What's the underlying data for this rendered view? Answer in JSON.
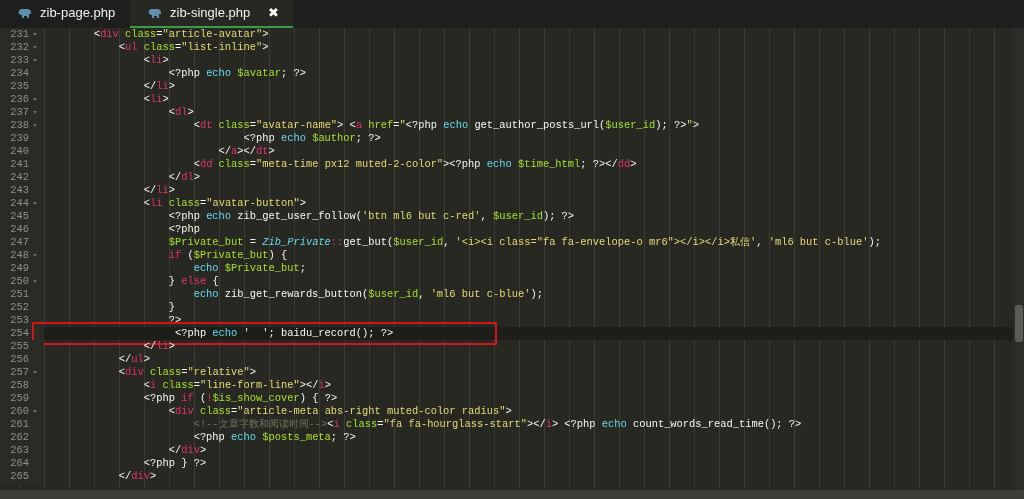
{
  "tabs": [
    {
      "label": "zib-page.php",
      "selected": false
    },
    {
      "label": "zib-single.php",
      "selected": true,
      "close": "✖"
    }
  ],
  "lines": [
    {
      "number": "231",
      "foldable": true,
      "current": false,
      "marked": false,
      "tokens": [
        {
          "kind": "p",
          "text": "        <"
        },
        {
          "kind": "t",
          "text": "div "
        },
        {
          "kind": "a",
          "text": "class"
        },
        {
          "kind": "p",
          "text": "="
        },
        {
          "kind": "s",
          "text": "\"article-avatar\""
        },
        {
          "kind": "p",
          "text": ">"
        }
      ]
    },
    {
      "number": "232",
      "foldable": true,
      "current": false,
      "marked": false,
      "tokens": [
        {
          "kind": "p",
          "text": "            <"
        },
        {
          "kind": "t",
          "text": "ul "
        },
        {
          "kind": "a",
          "text": "class"
        },
        {
          "kind": "p",
          "text": "="
        },
        {
          "kind": "s",
          "text": "\"list-inline\""
        },
        {
          "kind": "p",
          "text": ">"
        }
      ]
    },
    {
      "number": "233",
      "foldable": true,
      "current": false,
      "marked": false,
      "tokens": [
        {
          "kind": "p",
          "text": "                <"
        },
        {
          "kind": "t",
          "text": "li"
        },
        {
          "kind": "p",
          "text": ">"
        }
      ]
    },
    {
      "number": "234",
      "foldable": false,
      "current": false,
      "marked": false,
      "tokens": [
        {
          "kind": "p",
          "text": "                    <?php "
        },
        {
          "kind": "e",
          "text": "echo "
        },
        {
          "kind": "v",
          "text": "$avatar"
        },
        {
          "kind": "p",
          "text": "; ?>"
        }
      ]
    },
    {
      "number": "235",
      "foldable": false,
      "current": false,
      "marked": false,
      "tokens": [
        {
          "kind": "p",
          "text": "                </"
        },
        {
          "kind": "t",
          "text": "li"
        },
        {
          "kind": "p",
          "text": ">"
        }
      ]
    },
    {
      "number": "236",
      "foldable": true,
      "current": false,
      "marked": false,
      "tokens": [
        {
          "kind": "p",
          "text": "                <"
        },
        {
          "kind": "t",
          "text": "li"
        },
        {
          "kind": "p",
          "text": ">"
        }
      ]
    },
    {
      "number": "237",
      "foldable": true,
      "current": false,
      "marked": false,
      "tokens": [
        {
          "kind": "p",
          "text": "                    <"
        },
        {
          "kind": "t",
          "text": "dl"
        },
        {
          "kind": "p",
          "text": ">"
        }
      ]
    },
    {
      "number": "238",
      "foldable": true,
      "current": false,
      "marked": false,
      "tokens": [
        {
          "kind": "p",
          "text": "                        <"
        },
        {
          "kind": "t",
          "text": "dt "
        },
        {
          "kind": "a",
          "text": "class"
        },
        {
          "kind": "p",
          "text": "="
        },
        {
          "kind": "s",
          "text": "\"avatar-name\""
        },
        {
          "kind": "p",
          "text": "> <"
        },
        {
          "kind": "t",
          "text": "a "
        },
        {
          "kind": "a",
          "text": "href"
        },
        {
          "kind": "p",
          "text": "="
        },
        {
          "kind": "s",
          "text": "\""
        },
        {
          "kind": "p",
          "text": "<?php "
        },
        {
          "kind": "e",
          "text": "echo"
        },
        {
          "kind": "p",
          "text": " get_author_posts_url("
        },
        {
          "kind": "v",
          "text": "$user_id"
        },
        {
          "kind": "p",
          "text": "); ?>"
        },
        {
          "kind": "s",
          "text": "\""
        },
        {
          "kind": "p",
          "text": ">"
        }
      ]
    },
    {
      "number": "239",
      "foldable": false,
      "current": false,
      "marked": false,
      "tokens": [
        {
          "kind": "p",
          "text": "                                <?php "
        },
        {
          "kind": "e",
          "text": "echo "
        },
        {
          "kind": "v",
          "text": "$author"
        },
        {
          "kind": "p",
          "text": "; ?>"
        }
      ]
    },
    {
      "number": "240",
      "foldable": false,
      "current": false,
      "marked": false,
      "tokens": [
        {
          "kind": "p",
          "text": "                            </"
        },
        {
          "kind": "t",
          "text": "a"
        },
        {
          "kind": "p",
          "text": "></"
        },
        {
          "kind": "t",
          "text": "dt"
        },
        {
          "kind": "p",
          "text": ">"
        }
      ]
    },
    {
      "number": "241",
      "foldable": false,
      "current": false,
      "marked": false,
      "tokens": [
        {
          "kind": "p",
          "text": "                        <"
        },
        {
          "kind": "t",
          "text": "dd "
        },
        {
          "kind": "a",
          "text": "class"
        },
        {
          "kind": "p",
          "text": "="
        },
        {
          "kind": "s",
          "text": "\"meta-time px12 muted-2-color\""
        },
        {
          "kind": "p",
          "text": "><?php "
        },
        {
          "kind": "e",
          "text": "echo "
        },
        {
          "kind": "v",
          "text": "$time_html"
        },
        {
          "kind": "p",
          "text": "; ?></"
        },
        {
          "kind": "t",
          "text": "dd"
        },
        {
          "kind": "p",
          "text": ">"
        }
      ]
    },
    {
      "number": "242",
      "foldable": false,
      "current": false,
      "marked": false,
      "tokens": [
        {
          "kind": "p",
          "text": "                    </"
        },
        {
          "kind": "t",
          "text": "dl"
        },
        {
          "kind": "p",
          "text": ">"
        }
      ]
    },
    {
      "number": "243",
      "foldable": false,
      "current": false,
      "marked": false,
      "tokens": [
        {
          "kind": "p",
          "text": "                </"
        },
        {
          "kind": "t",
          "text": "li"
        },
        {
          "kind": "p",
          "text": ">"
        }
      ]
    },
    {
      "number": "244",
      "foldable": true,
      "current": false,
      "marked": false,
      "tokens": [
        {
          "kind": "p",
          "text": "                <"
        },
        {
          "kind": "t",
          "text": "li "
        },
        {
          "kind": "a",
          "text": "class"
        },
        {
          "kind": "p",
          "text": "="
        },
        {
          "kind": "s",
          "text": "\"avatar-button\""
        },
        {
          "kind": "p",
          "text": ">"
        }
      ]
    },
    {
      "number": "245",
      "foldable": false,
      "current": false,
      "marked": false,
      "tokens": [
        {
          "kind": "p",
          "text": "                    <?php "
        },
        {
          "kind": "e",
          "text": "echo"
        },
        {
          "kind": "p",
          "text": " zib_get_user_follow("
        },
        {
          "kind": "s",
          "text": "'btn ml6 but c-red'"
        },
        {
          "kind": "p",
          "text": ", "
        },
        {
          "kind": "v",
          "text": "$user_id"
        },
        {
          "kind": "p",
          "text": "); ?>"
        }
      ]
    },
    {
      "number": "246",
      "foldable": false,
      "current": false,
      "marked": false,
      "tokens": [
        {
          "kind": "p",
          "text": "                    <?php"
        }
      ]
    },
    {
      "number": "247",
      "foldable": false,
      "current": false,
      "marked": false,
      "tokens": [
        {
          "kind": "v",
          "text": "                    $Private_but"
        },
        {
          "kind": "p",
          "text": " = "
        },
        {
          "kind": "c",
          "text": "Zib_Private"
        },
        {
          "kind": "r",
          "text": "::"
        },
        {
          "kind": "p",
          "text": "get_but("
        },
        {
          "kind": "v",
          "text": "$user_id"
        },
        {
          "kind": "p",
          "text": ", "
        },
        {
          "kind": "s",
          "text": "'<i><i class=\"fa fa-envelope-o mr6\"></i></i>私信'"
        },
        {
          "kind": "p",
          "text": ", "
        },
        {
          "kind": "s",
          "text": "'ml6 but c-blue'"
        },
        {
          "kind": "p",
          "text": ");"
        }
      ]
    },
    {
      "number": "248",
      "foldable": true,
      "current": false,
      "marked": false,
      "tokens": [
        {
          "kind": "r",
          "text": "                    if"
        },
        {
          "kind": "p",
          "text": " ("
        },
        {
          "kind": "v",
          "text": "$Private_but"
        },
        {
          "kind": "p",
          "text": ") {"
        }
      ]
    },
    {
      "number": "249",
      "foldable": false,
      "current": false,
      "marked": false,
      "tokens": [
        {
          "kind": "e",
          "text": "                        echo "
        },
        {
          "kind": "v",
          "text": "$Private_but"
        },
        {
          "kind": "p",
          "text": ";"
        }
      ]
    },
    {
      "number": "250",
      "foldable": true,
      "current": false,
      "marked": false,
      "tokens": [
        {
          "kind": "p",
          "text": "                    } "
        },
        {
          "kind": "r",
          "text": "else"
        },
        {
          "kind": "p",
          "text": " {"
        }
      ]
    },
    {
      "number": "251",
      "foldable": false,
      "current": false,
      "marked": false,
      "tokens": [
        {
          "kind": "e",
          "text": "                        echo"
        },
        {
          "kind": "p",
          "text": " zib_get_rewards_button("
        },
        {
          "kind": "v",
          "text": "$user_id"
        },
        {
          "kind": "p",
          "text": ", "
        },
        {
          "kind": "s",
          "text": "'ml6 but c-blue'"
        },
        {
          "kind": "p",
          "text": ");"
        }
      ]
    },
    {
      "number": "252",
      "foldable": false,
      "current": false,
      "marked": false,
      "tokens": [
        {
          "kind": "p",
          "text": "                    }"
        }
      ]
    },
    {
      "number": "253",
      "foldable": false,
      "current": false,
      "marked": false,
      "tokens": [
        {
          "kind": "p",
          "text": "                    ?>"
        }
      ]
    },
    {
      "number": "254",
      "foldable": false,
      "current": true,
      "marked": true,
      "tokens": [
        {
          "kind": "p",
          "text": "                     <?php "
        },
        {
          "kind": "e",
          "text": "echo"
        },
        {
          "kind": "p",
          "text": " '  '; baidu_record(); ?>"
        }
      ]
    },
    {
      "number": "255",
      "foldable": false,
      "current": false,
      "marked": false,
      "tokens": [
        {
          "kind": "p",
          "text": "                </"
        },
        {
          "kind": "t",
          "text": "li"
        },
        {
          "kind": "p",
          "text": ">"
        }
      ]
    },
    {
      "number": "256",
      "foldable": false,
      "current": false,
      "marked": false,
      "tokens": [
        {
          "kind": "p",
          "text": "            </"
        },
        {
          "kind": "t",
          "text": "ul"
        },
        {
          "kind": "p",
          "text": ">"
        }
      ]
    },
    {
      "number": "257",
      "foldable": true,
      "current": false,
      "marked": false,
      "tokens": [
        {
          "kind": "p",
          "text": "            <"
        },
        {
          "kind": "t",
          "text": "div "
        },
        {
          "kind": "a",
          "text": "class"
        },
        {
          "kind": "p",
          "text": "="
        },
        {
          "kind": "s",
          "text": "\"relative\""
        },
        {
          "kind": "p",
          "text": ">"
        }
      ]
    },
    {
      "number": "258",
      "foldable": false,
      "current": false,
      "marked": false,
      "tokens": [
        {
          "kind": "p",
          "text": "                <"
        },
        {
          "kind": "t",
          "text": "i "
        },
        {
          "kind": "a",
          "text": "class"
        },
        {
          "kind": "p",
          "text": "="
        },
        {
          "kind": "s",
          "text": "\"line-form-line\""
        },
        {
          "kind": "p",
          "text": "></"
        },
        {
          "kind": "t",
          "text": "i"
        },
        {
          "kind": "p",
          "text": ">"
        }
      ]
    },
    {
      "number": "259",
      "foldable": false,
      "current": false,
      "marked": false,
      "tokens": [
        {
          "kind": "p",
          "text": "                <?php "
        },
        {
          "kind": "r",
          "text": "if"
        },
        {
          "kind": "p",
          "text": " ("
        },
        {
          "kind": "r",
          "text": "!"
        },
        {
          "kind": "v",
          "text": "$is_show_cover"
        },
        {
          "kind": "p",
          "text": ") { ?>"
        }
      ]
    },
    {
      "number": "260",
      "foldable": true,
      "current": false,
      "marked": false,
      "tokens": [
        {
          "kind": "p",
          "text": "                    <"
        },
        {
          "kind": "t",
          "text": "div "
        },
        {
          "kind": "a",
          "text": "class"
        },
        {
          "kind": "p",
          "text": "="
        },
        {
          "kind": "s",
          "text": "\"article-meta abs-right muted-color radius\""
        },
        {
          "kind": "p",
          "text": ">"
        }
      ]
    },
    {
      "number": "261",
      "foldable": false,
      "current": false,
      "marked": false,
      "tokens": [
        {
          "kind": "m",
          "text": "                        <!--文章字数和阅读时间-->"
        },
        {
          "kind": "p",
          "text": "<"
        },
        {
          "kind": "t",
          "text": "i "
        },
        {
          "kind": "a",
          "text": "class"
        },
        {
          "kind": "p",
          "text": "="
        },
        {
          "kind": "s",
          "text": "\"fa fa-hourglass-start\""
        },
        {
          "kind": "p",
          "text": "></"
        },
        {
          "kind": "t",
          "text": "i"
        },
        {
          "kind": "p",
          "text": "> <?php "
        },
        {
          "kind": "e",
          "text": "echo"
        },
        {
          "kind": "p",
          "text": " count_words_read_time(); ?>"
        }
      ]
    },
    {
      "number": "262",
      "foldable": false,
      "current": false,
      "marked": false,
      "tokens": [
        {
          "kind": "p",
          "text": "                        <?php "
        },
        {
          "kind": "e",
          "text": "echo "
        },
        {
          "kind": "v",
          "text": "$posts_meta"
        },
        {
          "kind": "p",
          "text": "; ?>"
        }
      ]
    },
    {
      "number": "263",
      "foldable": false,
      "current": false,
      "marked": false,
      "tokens": [
        {
          "kind": "p",
          "text": "                    </"
        },
        {
          "kind": "t",
          "text": "div"
        },
        {
          "kind": "p",
          "text": ">"
        }
      ]
    },
    {
      "number": "264",
      "foldable": false,
      "current": false,
      "marked": false,
      "tokens": [
        {
          "kind": "p",
          "text": "                <?php } ?>"
        }
      ]
    },
    {
      "number": "265",
      "foldable": false,
      "current": false,
      "marked": false,
      "tokens": [
        {
          "kind": "p",
          "text": "            </"
        },
        {
          "kind": "t",
          "text": "div"
        },
        {
          "kind": "p",
          "text": ">"
        }
      ]
    }
  ]
}
